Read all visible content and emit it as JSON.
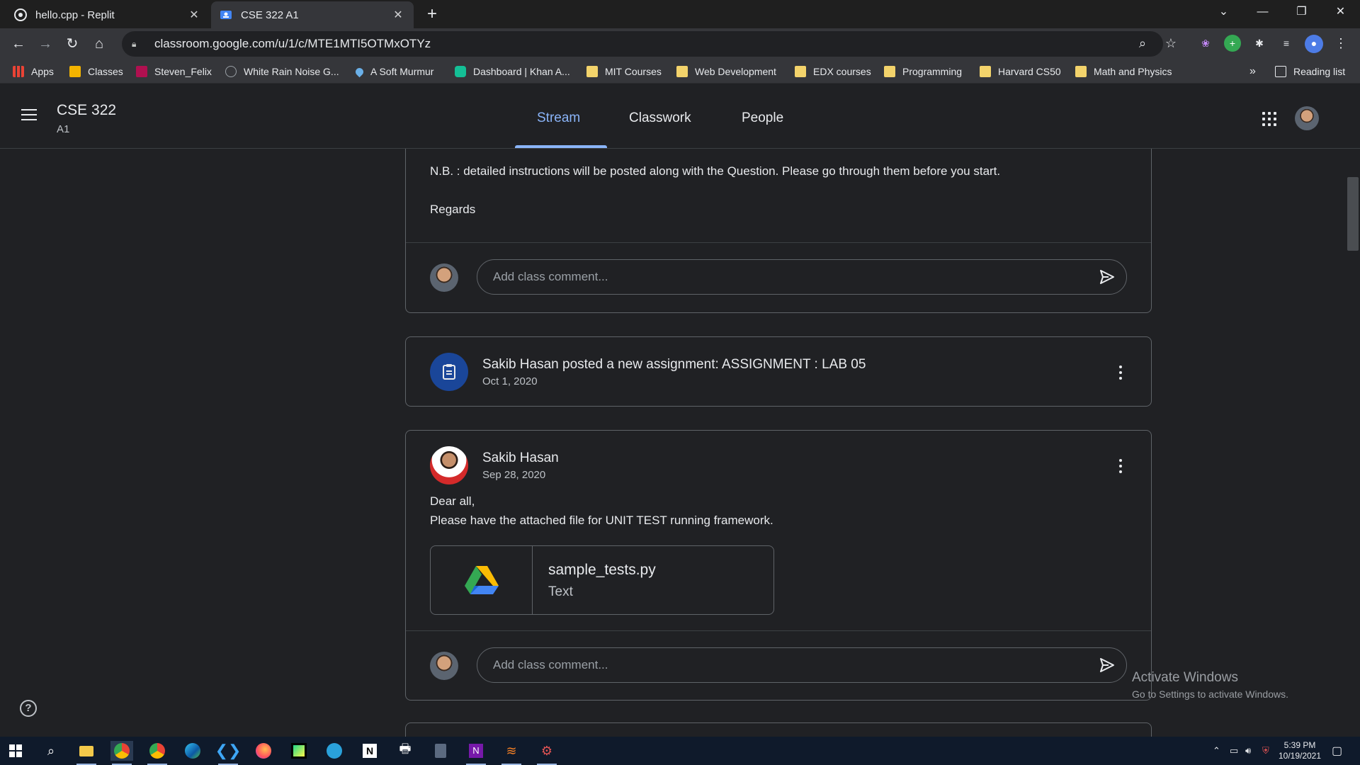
{
  "browser": {
    "tabs": [
      {
        "title": "hello.cpp - Replit",
        "active": false
      },
      {
        "title": "CSE 322 A1",
        "active": true
      }
    ],
    "url": "classroom.google.com/u/1/c/MTE1MTI5OTMxOTYz",
    "bookmarks": [
      {
        "label": "Apps",
        "icon": "apps-grid-icon"
      },
      {
        "label": "Classes",
        "icon": "classroom-icon"
      },
      {
        "label": "Steven_Felix",
        "icon": "uva-icon"
      },
      {
        "label": "White Rain Noise G...",
        "icon": "noise-icon"
      },
      {
        "label": "A Soft Murmur",
        "icon": "drop-icon"
      },
      {
        "label": "Dashboard | Khan A...",
        "icon": "khan-icon"
      },
      {
        "label": "MIT Courses",
        "icon": "folder-icon"
      },
      {
        "label": "Web Development",
        "icon": "folder-icon"
      },
      {
        "label": "EDX courses",
        "icon": "folder-icon"
      },
      {
        "label": "Programming",
        "icon": "folder-icon"
      },
      {
        "label": "Harvard CS50",
        "icon": "folder-icon"
      },
      {
        "label": "Math and Physics",
        "icon": "folder-icon"
      }
    ],
    "overflow_label": "»",
    "reading_list": "Reading list"
  },
  "classroom": {
    "class_name": "CSE 322",
    "section": "A1",
    "tabs": [
      {
        "label": "Stream",
        "active": true
      },
      {
        "label": "Classwork",
        "active": false
      },
      {
        "label": "People",
        "active": false
      }
    ]
  },
  "stream": {
    "post1": {
      "body_lines": [
        "N.B. : detailed instructions will be posted along with the Question. Please go through them before you start.",
        "Regards"
      ],
      "comment_placeholder": "Add class comment..."
    },
    "assignment": {
      "title": "Sakib Hasan posted a new assignment: ASSIGNMENT : LAB 05",
      "date": "Oct 1, 2020"
    },
    "post2": {
      "author": "Sakib Hasan",
      "date": "Sep 28, 2020",
      "body_lines": [
        "Dear all,",
        "Please have the attached file for UNIT TEST running framework."
      ],
      "attachment": {
        "name": "sample_tests.py",
        "type": "Text"
      },
      "comment_placeholder": "Add class comment..."
    }
  },
  "watermark": {
    "line1": "Activate Windows",
    "line2": "Go to Settings to activate Windows."
  },
  "taskbar": {
    "time": "5:39 PM",
    "date": "10/19/2021"
  },
  "colors": {
    "accent": "#8ab4f8",
    "background": "#202124",
    "assignment_icon_bg": "#1a4699"
  }
}
